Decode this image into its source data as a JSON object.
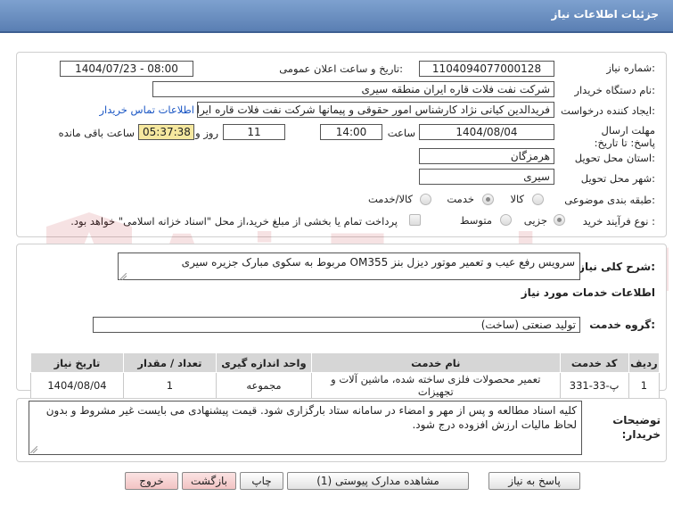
{
  "header": {
    "title": "جزئیات اطلاعات نیاز"
  },
  "form": {
    "need_number_label": "شماره نیاز:",
    "need_number": "1104094077000128",
    "announce_label": "تاریخ و ساعت اعلان عمومی:",
    "announce_value": "1404/07/23 - 08:00",
    "buyer_org_label": "نام دستگاه خریدار:",
    "buyer_org": "شرکت نفت فلات قاره ایران منطقه سیری",
    "requester_label": "ایجاد کننده درخواست:",
    "requester": "فریدالدین کیانی نژاد کارشناس امور حقوقی و پیمانها شرکت نفت فلات قاره ایران",
    "contact_link": "اطلاعات تماس خریدار",
    "deadline_label": "مهلت ارسال پاسخ: تا تاریخ:",
    "deadline_date": "1404/08/04",
    "time_label": "ساعت",
    "deadline_time": "14:00",
    "days_value": "11",
    "days_label": "روز و",
    "remaining_time": "05:37:38",
    "remaining_label": "ساعت باقی مانده",
    "province_label": "استان محل تحویل:",
    "province": "هرمزگان",
    "city_label": "شهر محل تحویل:",
    "city": "سیری",
    "category_label": "طبقه بندی موضوعی:",
    "category_options": [
      "کالا",
      "خدمت",
      "کالا/خدمت"
    ],
    "category_selected": "خدمت",
    "process_label": "نوع فرآیند خرید :",
    "process_options": [
      "جزیی",
      "متوسط"
    ],
    "process_selected": "جزیی",
    "payment_note": "پرداخت تمام یا بخشی از مبلغ خرید،از محل \"اسناد خزانه اسلامی\" خواهد بود."
  },
  "summary": {
    "label": "شرح کلی نیاز:",
    "text": "سرویس رفع عیب و تعمیر موتور دیزل بنز OM355 مربوط به سکوی مبارک جزیره سیری"
  },
  "services": {
    "section_title": "اطلاعات خدمات مورد نیاز",
    "group_label": "گروه خدمت:",
    "group_value": "تولید صنعتی (ساخت)",
    "columns": [
      "ردیف",
      "کد خدمت",
      "نام خدمت",
      "واحد اندازه گیری",
      "تعداد / مقدار",
      "تاریخ نیاز"
    ],
    "rows": [
      [
        "1",
        "پ-33-331",
        "تعمیر محصولات فلزی ساخته شده، ماشین آلات و تجهیزات",
        "مجموعه",
        "1",
        "1404/08/04"
      ]
    ]
  },
  "notes": {
    "label": "توضیحات خریدار:",
    "text": "کلیه اسناد مطالعه و پس از مهر و امضاء در سامانه ستاد بارگزاری شود. قیمت پیشنهادی می بایست غیر مشروط و بدون لحاظ مالیات ارزش افزوده درج شود."
  },
  "buttons": {
    "reply": "پاسخ به نیاز",
    "attachments": "مشاهده مدارک پیوستی (1)",
    "print": "چاپ",
    "back": "بازگشت",
    "exit": "خروج"
  },
  "colors": {
    "header_blue": "#6a8fc4",
    "link_blue": "#1a56c4",
    "remaining_bg": "#f6e89f",
    "exit_pink": "#f2c3c3",
    "watermark_red": "#c0282d"
  }
}
